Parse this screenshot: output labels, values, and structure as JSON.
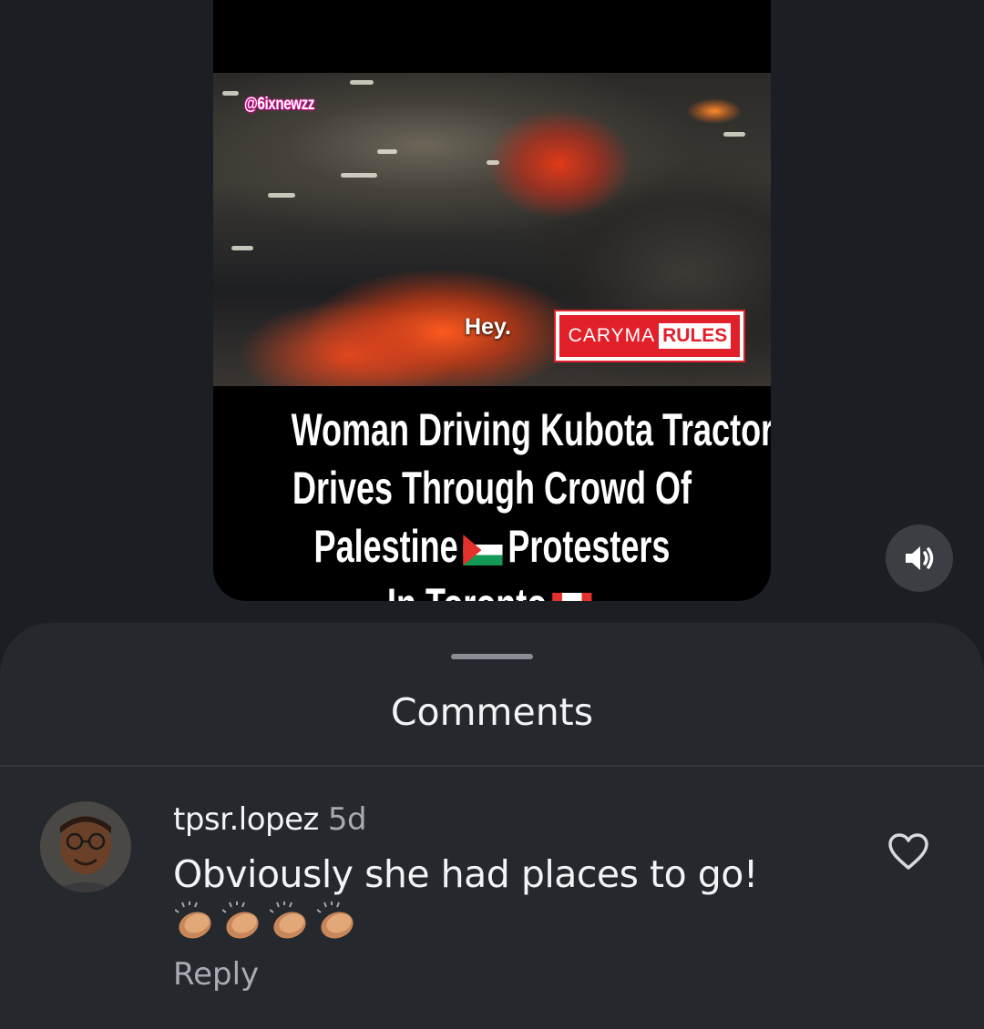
{
  "video": {
    "watermark": "@6ixnewzz",
    "subtitle": "Hey.",
    "brand_badge": {
      "word1": "CARYMA",
      "word2": "RULES"
    },
    "headline_lines": [
      "Woman Driving Kubota Tractor",
      "Drives Through Crowd Of",
      "Palestine",
      "Protesters",
      "In Toronto"
    ]
  },
  "sound_button": {
    "icon": "speaker-icon"
  },
  "comments_sheet": {
    "title": "Comments",
    "comments": [
      {
        "username": "tpsr.lopez",
        "time": "5d",
        "text": "Obviously she had places to go!",
        "emoji": "clapping-hands x4",
        "reply_label": "Reply",
        "like_icon": "heart-icon"
      }
    ]
  }
}
